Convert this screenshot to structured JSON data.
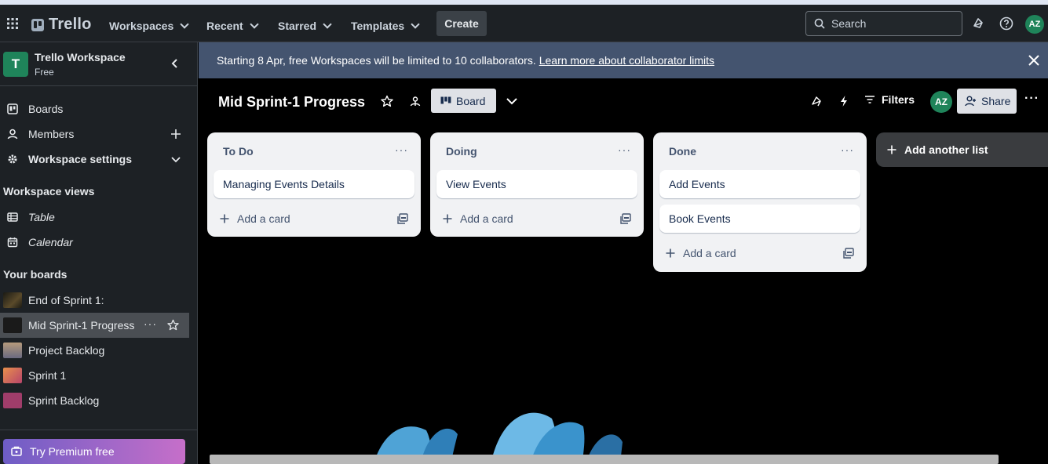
{
  "topnav": {
    "brand": "Trello",
    "menus": [
      "Workspaces",
      "Recent",
      "Starred",
      "Templates"
    ],
    "create_label": "Create",
    "search_placeholder": "Search",
    "avatar_initials": "AZ"
  },
  "sidebar": {
    "workspace_initial": "T",
    "workspace_name": "Trello Workspace",
    "workspace_plan": "Free",
    "items": [
      {
        "label": "Boards"
      },
      {
        "label": "Members"
      },
      {
        "label": "Workspace settings"
      }
    ],
    "views_heading": "Workspace views",
    "views": [
      {
        "label": "Table"
      },
      {
        "label": "Calendar"
      }
    ],
    "boards_heading": "Your boards",
    "boards": [
      {
        "label": "End of Sprint 1:",
        "color": "#2b2a1e"
      },
      {
        "label": "Mid Sprint-1 Progress",
        "color": "#1a1a1a"
      },
      {
        "label": "Project Backlog",
        "color": "#8a7560"
      },
      {
        "label": "Sprint 1",
        "color": "#d26a4a"
      },
      {
        "label": "Sprint Backlog",
        "color": "#a03d6a"
      }
    ],
    "premium_label": "Try Premium free"
  },
  "banner": {
    "text": "Starting 8 Apr, free Workspaces will be limited to 10 collaborators.",
    "link": "Learn more about collaborator limits"
  },
  "board": {
    "title": "Mid Sprint-1 Progress",
    "view_label": "Board",
    "filters_label": "Filters",
    "share_label": "Share",
    "member_initials": "AZ",
    "add_list_label": "Add another list",
    "lists": [
      {
        "title": "To Do",
        "cards": [
          "Managing Events Details"
        ],
        "add_label": "Add a card"
      },
      {
        "title": "Doing",
        "cards": [
          "View Events"
        ],
        "add_label": "Add a card"
      },
      {
        "title": "Done",
        "cards": [
          "Add Events",
          "Book Events"
        ],
        "add_label": "Add a card"
      }
    ]
  },
  "colors": {
    "topbar": "#1d2125",
    "banner": "#44546f",
    "list_bg": "#f1f2f4",
    "avatar": "#1f845a"
  }
}
